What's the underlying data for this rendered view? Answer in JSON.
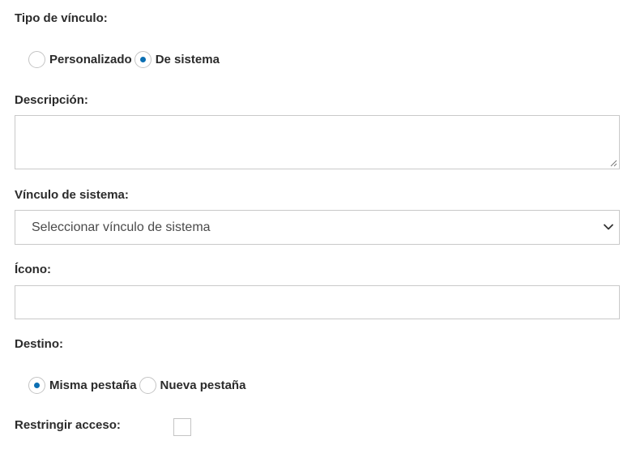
{
  "link_type": {
    "label": "Tipo de vínculo:",
    "options": [
      {
        "label": "Personalizado",
        "checked": false
      },
      {
        "label": "De sistema",
        "checked": true
      }
    ]
  },
  "description": {
    "label": "Descripción:",
    "value": ""
  },
  "system_link": {
    "label": "Vínculo de sistema:",
    "selected": "Seleccionar vínculo de sistema"
  },
  "icon": {
    "label": "Ícono:",
    "value": ""
  },
  "target": {
    "label": "Destino:",
    "options": [
      {
        "label": "Misma pestaña",
        "checked": true
      },
      {
        "label": "Nueva pestaña",
        "checked": false
      }
    ]
  },
  "restrict_access": {
    "label": "Restringir acceso:",
    "checked": false
  },
  "colors": {
    "accent": "#0b6fb3",
    "border": "#c9c9c9",
    "label_text": "#2b2b2b"
  }
}
